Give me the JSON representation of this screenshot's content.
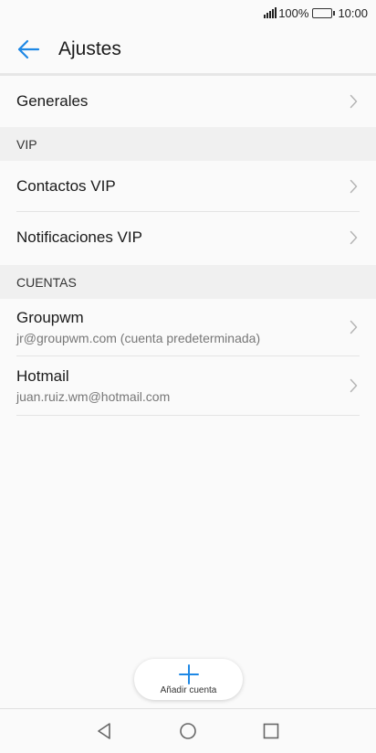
{
  "status": {
    "battery_pct": "100%",
    "time": "10:00"
  },
  "header": {
    "title": "Ajustes",
    "back_icon": "arrow-left-icon"
  },
  "items": {
    "general": {
      "label": "Generales"
    }
  },
  "sections": {
    "vip": {
      "header": "VIP",
      "items": [
        {
          "label": "Contactos VIP"
        },
        {
          "label": "Notificaciones VIP"
        }
      ]
    },
    "accounts": {
      "header": "CUENTAS",
      "items": [
        {
          "label": "Groupwm",
          "detail": "jr@groupwm.com (cuenta predeterminada)"
        },
        {
          "label": "Hotmail",
          "detail": "juan.ruiz.wm@hotmail.com"
        }
      ]
    }
  },
  "fab": {
    "icon": "plus-icon",
    "label": "Añadir cuenta"
  },
  "colors": {
    "accent": "#1e88e5",
    "background": "#fafafa",
    "section_bg": "#f0f0f0"
  }
}
